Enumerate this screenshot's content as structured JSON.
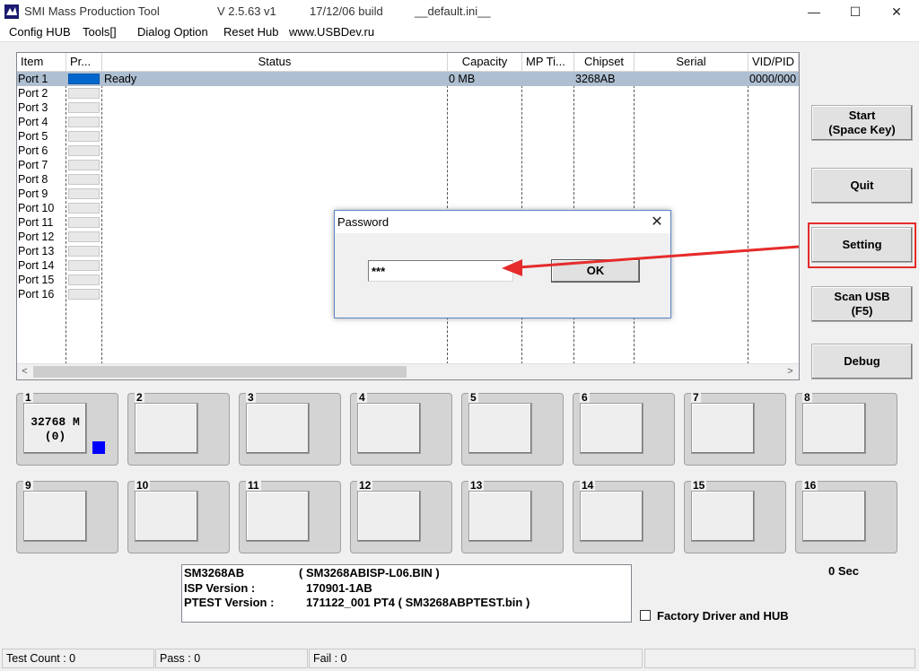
{
  "window": {
    "app_name": "SMI Mass Production Tool",
    "version": "V 2.5.63   v1",
    "build": "17/12/06 build",
    "ini": "__default.ini__",
    "minimize_glyph": "—",
    "maximize_glyph": "☐",
    "close_glyph": "✕"
  },
  "menu": [
    "Config HUB",
    "Tools[]",
    "Dialog Option",
    "Reset Hub",
    "www.USBDev.ru"
  ],
  "list": {
    "columns": [
      "Item",
      "Pr...",
      "Status",
      "Capacity",
      "MP Ti...",
      "Chipset",
      "Serial",
      "VID/PID"
    ],
    "ports": [
      "Port 1",
      "Port 2",
      "Port 3",
      "Port 4",
      "Port 5",
      "Port 6",
      "Port 7",
      "Port 8",
      "Port 9",
      "Port 10",
      "Port 11",
      "Port 12",
      "Port 13",
      "Port 14",
      "Port 15",
      "Port 16"
    ],
    "selected_row": {
      "status": "Ready",
      "capacity": "0 MB",
      "chipset": "3268AB",
      "vidpid": "0000/000"
    },
    "scroll_left": "<",
    "scroll_right": ">"
  },
  "buttons": {
    "start": "Start",
    "start_sub": "(Space Key)",
    "quit": "Quit",
    "setting": "Setting",
    "scan": "Scan USB",
    "scan_sub": "(F5)",
    "debug": "Debug"
  },
  "slots": {
    "labels": [
      "1",
      "2",
      "3",
      "4",
      "5",
      "6",
      "7",
      "8",
      "9",
      "10",
      "11",
      "12",
      "13",
      "14",
      "15",
      "16"
    ],
    "slot1_capacity": "32768 M",
    "slot1_count": "(0)"
  },
  "info": {
    "chip": "SM3268AB",
    "isp_file": "( SM3268ABISP-L06.BIN )",
    "isp_label": "ISP Version :",
    "isp_value": "170901-1AB",
    "ptest_label": "PTEST Version :",
    "ptest_value": "171122_001   PT4 ( SM3268ABPTEST.bin )"
  },
  "timer": "0 Sec",
  "factory_checkbox": "Factory Driver and HUB",
  "status_bar": {
    "test_count": "Test Count : 0",
    "pass": "Pass : 0",
    "fail": "Fail : 0"
  },
  "dialog": {
    "title": "Password",
    "password_value": "***",
    "ok": "OK",
    "close_glyph": "✕"
  },
  "annotation_color": "#e52b2b",
  "progress_color": "#0066cc"
}
